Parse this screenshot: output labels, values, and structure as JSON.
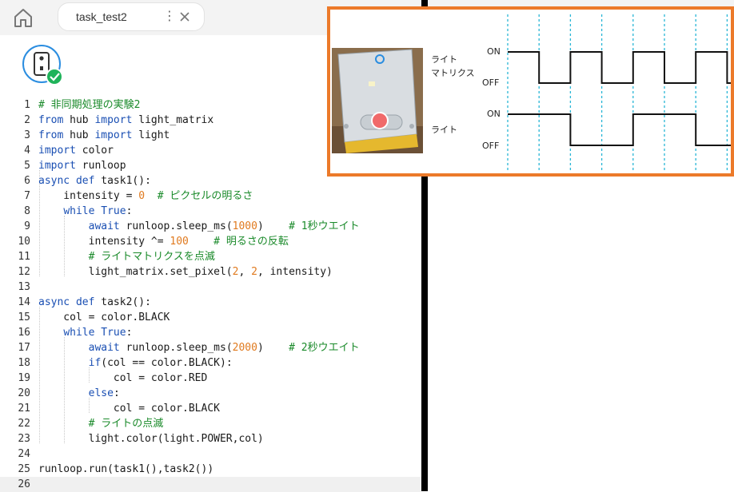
{
  "tab": {
    "label": "task_test2",
    "menu_glyph": "⋮"
  },
  "icons": {
    "home": "home-icon",
    "hub_connected": "hub-connected-icon",
    "close": "close-icon",
    "menu": "more-vert-icon"
  },
  "colors": {
    "keyword": "#1a4fb3",
    "comment": "#1a8a2a",
    "number": "#e07a1f",
    "accent": "#ec7a2a",
    "hub_blue": "#2a8de0",
    "hub_green": "#1fb35a",
    "timing_grid": "#29b6d6"
  },
  "code_lines": [
    [
      {
        "t": "cm",
        "v": "# 非同期処理の実験2"
      }
    ],
    [
      {
        "t": "kw",
        "v": "from"
      },
      {
        "t": "",
        "v": " hub "
      },
      {
        "t": "kw",
        "v": "import"
      },
      {
        "t": "",
        "v": " light_matrix"
      }
    ],
    [
      {
        "t": "kw",
        "v": "from"
      },
      {
        "t": "",
        "v": " hub "
      },
      {
        "t": "kw",
        "v": "import"
      },
      {
        "t": "",
        "v": " light"
      }
    ],
    [
      {
        "t": "kw",
        "v": "import"
      },
      {
        "t": "",
        "v": " color"
      }
    ],
    [
      {
        "t": "kw",
        "v": "import"
      },
      {
        "t": "",
        "v": " runloop"
      }
    ],
    [
      {
        "t": "kw",
        "v": "async def"
      },
      {
        "t": "",
        "v": " task1():"
      }
    ],
    [
      {
        "t": "",
        "v": "    intensity = "
      },
      {
        "t": "num",
        "v": "0"
      },
      {
        "t": "",
        "v": "  "
      },
      {
        "t": "cm",
        "v": "# ピクセルの明るさ"
      }
    ],
    [
      {
        "t": "",
        "v": "    "
      },
      {
        "t": "kw",
        "v": "while True"
      },
      {
        "t": "",
        "v": ":"
      }
    ],
    [
      {
        "t": "",
        "v": "        "
      },
      {
        "t": "kw",
        "v": "await"
      },
      {
        "t": "",
        "v": " runloop.sleep_ms("
      },
      {
        "t": "num",
        "v": "1000"
      },
      {
        "t": "",
        "v": ")    "
      },
      {
        "t": "cm",
        "v": "# 1秒ウエイト"
      }
    ],
    [
      {
        "t": "",
        "v": "        intensity ^= "
      },
      {
        "t": "num",
        "v": "100"
      },
      {
        "t": "",
        "v": "    "
      },
      {
        "t": "cm",
        "v": "# 明るさの反転"
      }
    ],
    [
      {
        "t": "",
        "v": "        "
      },
      {
        "t": "cm",
        "v": "# ライトマトリクスを点滅"
      }
    ],
    [
      {
        "t": "",
        "v": "        light_matrix.set_pixel("
      },
      {
        "t": "num",
        "v": "2"
      },
      {
        "t": "",
        "v": ", "
      },
      {
        "t": "num",
        "v": "2"
      },
      {
        "t": "",
        "v": ", intensity)"
      }
    ],
    [],
    [
      {
        "t": "kw",
        "v": "async def"
      },
      {
        "t": "",
        "v": " task2():"
      }
    ],
    [
      {
        "t": "",
        "v": "    col = color.BLACK"
      }
    ],
    [
      {
        "t": "",
        "v": "    "
      },
      {
        "t": "kw",
        "v": "while True"
      },
      {
        "t": "",
        "v": ":"
      }
    ],
    [
      {
        "t": "",
        "v": "        "
      },
      {
        "t": "kw",
        "v": "await"
      },
      {
        "t": "",
        "v": " runloop.sleep_ms("
      },
      {
        "t": "num",
        "v": "2000"
      },
      {
        "t": "",
        "v": ")    "
      },
      {
        "t": "cm",
        "v": "# 2秒ウエイト"
      }
    ],
    [
      {
        "t": "",
        "v": "        "
      },
      {
        "t": "kw",
        "v": "if"
      },
      {
        "t": "",
        "v": "(col == color.BLACK):"
      }
    ],
    [
      {
        "t": "",
        "v": "            col = color.RED"
      }
    ],
    [
      {
        "t": "",
        "v": "        "
      },
      {
        "t": "kw",
        "v": "else"
      },
      {
        "t": "",
        "v": ":"
      }
    ],
    [
      {
        "t": "",
        "v": "            col = color.BLACK"
      }
    ],
    [
      {
        "t": "",
        "v": "        "
      },
      {
        "t": "cm",
        "v": "# ライトの点滅"
      }
    ],
    [
      {
        "t": "",
        "v": "        light.color(light.POWER,col)"
      }
    ],
    [],
    [
      {
        "t": "",
        "v": "runloop.run(task1(),task2())"
      }
    ],
    []
  ],
  "active_line": 26,
  "diagram": {
    "labels": {
      "matrix_line1": "ライト",
      "matrix_line2": "マトリクス",
      "light": "ライト",
      "on": "ON",
      "off": "OFF"
    },
    "matrix_levels": [
      "ON",
      "OFF",
      "ON",
      "OFF",
      "ON",
      "OFF",
      "ON",
      "OFF"
    ],
    "light_levels": [
      "ON",
      "OFF",
      "ON",
      "OFF"
    ]
  }
}
